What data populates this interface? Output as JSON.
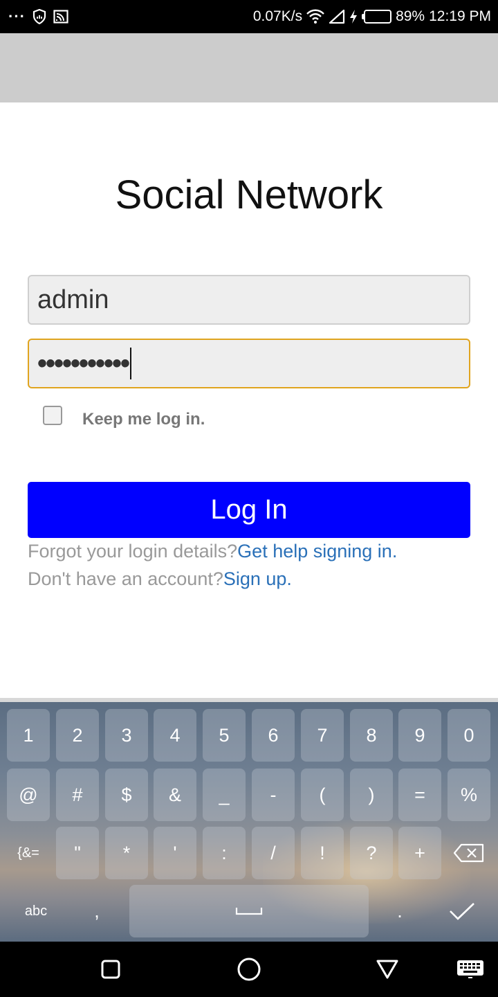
{
  "status_bar": {
    "network_speed": "0.07K/s",
    "battery_percent": "89%",
    "battery_level": 0.89,
    "time": "12:19 PM",
    "icons": [
      "more-dots-icon",
      "shield-icon",
      "cast-icon",
      "wifi-icon",
      "signal-icon",
      "charging-icon",
      "battery-icon"
    ]
  },
  "login": {
    "title": "Social Network",
    "username_value": "admin",
    "password_masked": "•••••••••••",
    "remember_label": "Keep me log in.",
    "remember_checked": false,
    "login_button": "Log In",
    "forgot_text": "Forgot your login details?",
    "forgot_link": "Get help signing in.",
    "signup_text": "Don't have an account?",
    "signup_link": "Sign up."
  },
  "keyboard": {
    "row1": [
      "1",
      "2",
      "3",
      "4",
      "5",
      "6",
      "7",
      "8",
      "9",
      "0"
    ],
    "row2": [
      "@",
      "#",
      "$",
      "&",
      "_",
      "-",
      "(",
      ")",
      "=",
      "%"
    ],
    "row3": [
      "{&=",
      "\"",
      "*",
      "'",
      ":",
      "/",
      "!",
      "?",
      "+"
    ],
    "abc_label": "abc",
    "comma": ",",
    "period": "."
  },
  "nav_bar": {
    "icons": [
      "recent-apps-icon",
      "home-icon",
      "back-icon",
      "keyboard-switch-icon"
    ]
  }
}
